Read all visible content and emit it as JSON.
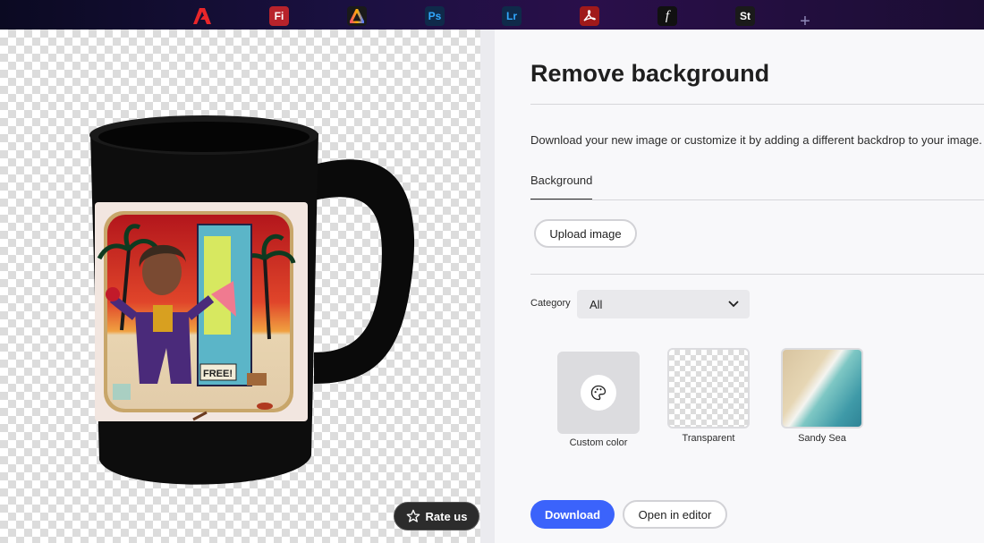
{
  "topbar": {
    "apps": [
      {
        "name": "adobe",
        "label": "",
        "bg": "transparent",
        "fg": "#e8262a"
      },
      {
        "name": "firefly",
        "label": "Fi",
        "bg": "#b8232b",
        "fg": "#ffffff"
      },
      {
        "name": "express",
        "label": "",
        "bg": "#1a1a1a",
        "fg": "#ffffff"
      },
      {
        "name": "photoshop",
        "label": "Ps",
        "bg": "#0f2a4a",
        "fg": "#31a8ff"
      },
      {
        "name": "lightroom",
        "label": "Lr",
        "bg": "#0f2a4a",
        "fg": "#31a8ff"
      },
      {
        "name": "acrobat",
        "label": "",
        "bg": "#a01a1a",
        "fg": "#ffffff"
      },
      {
        "name": "fonts",
        "label": "f",
        "bg": "#111111",
        "fg": "#ffffff"
      },
      {
        "name": "stock",
        "label": "St",
        "bg": "#1a1a1a",
        "fg": "#ffffff"
      }
    ],
    "plus": "+"
  },
  "canvas": {
    "rate_label": "Rate us",
    "mug_text": "FREE!"
  },
  "panel": {
    "title": "Remove background",
    "description": "Download your new image or customize it by adding a different backdrop to your image.",
    "tab_label": "Background",
    "upload_label": "Upload image",
    "category_label": "Category",
    "category_value": "All",
    "swatches": [
      {
        "label": "Custom color"
      },
      {
        "label": "Transparent"
      },
      {
        "label": "Sandy Sea"
      }
    ],
    "download_label": "Download",
    "open_editor_label": "Open in editor"
  },
  "colors": {
    "accent": "#3b63fb",
    "topbar": "#1a1040"
  }
}
